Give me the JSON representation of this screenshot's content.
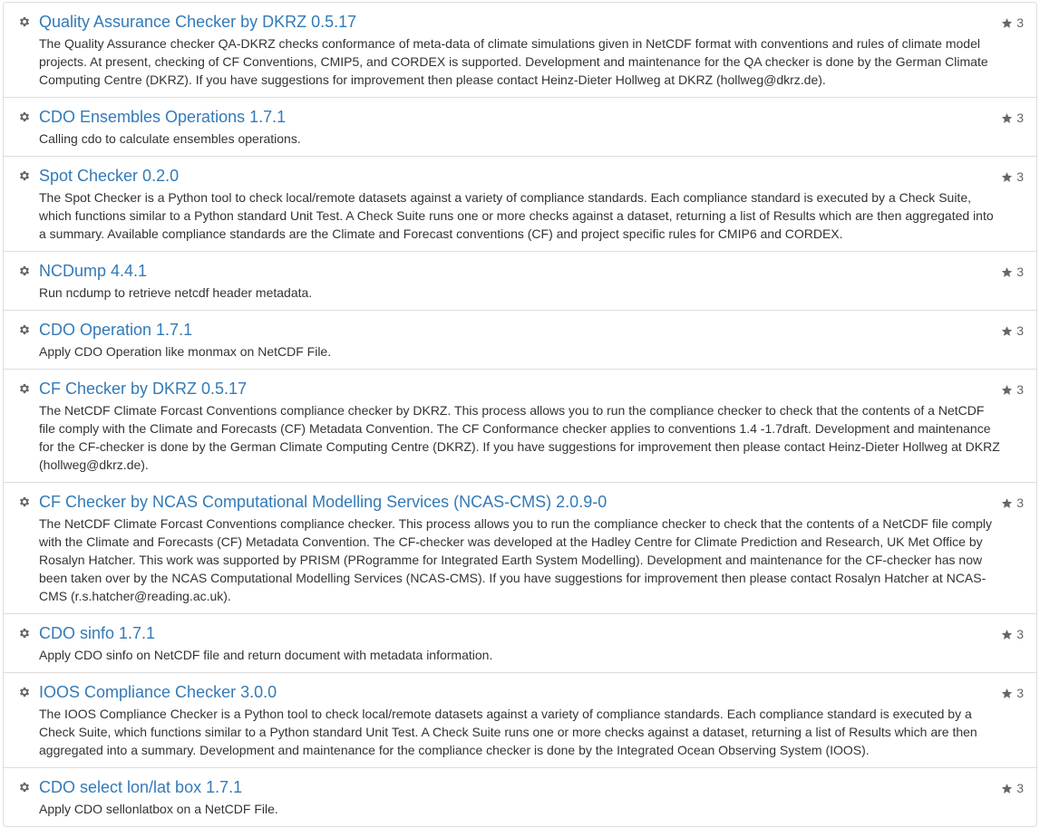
{
  "processes": [
    {
      "title": "Quality Assurance Checker by DKRZ 0.5.17",
      "description": "The Quality Assurance checker QA-DKRZ checks conformance of meta-data of climate simulations given in NetCDF format with conventions and rules of climate model projects. At present, checking of CF Conventions, CMIP5, and CORDEX is supported. Development and maintenance for the QA checker is done by the German Climate Computing Centre (DKRZ). If you have suggestions for improvement then please contact Heinz-Dieter Hollweg at DKRZ (hollweg@dkrz.de).",
      "stars": "3",
      "icon": "gear-icon"
    },
    {
      "title": "CDO Ensembles Operations 1.7.1",
      "description": "Calling cdo to calculate ensembles operations.",
      "stars": "3",
      "icon": "gear-icon"
    },
    {
      "title": "Spot Checker 0.2.0",
      "description": "The Spot Checker is a Python tool to check local/remote datasets against a variety of compliance standards. Each compliance standard is executed by a Check Suite, which functions similar to a Python standard Unit Test. A Check Suite runs one or more checks against a dataset, returning a list of Results which are then aggregated into a summary. Available compliance standards are the Climate and Forecast conventions (CF) and project specific rules for CMIP6 and CORDEX.",
      "stars": "3",
      "icon": "gear-icon"
    },
    {
      "title": "NCDump 4.4.1",
      "description": "Run ncdump to retrieve netcdf header metadata.",
      "stars": "3",
      "icon": "gear-icon"
    },
    {
      "title": "CDO Operation 1.7.1",
      "description": "Apply CDO Operation like monmax on NetCDF File.",
      "stars": "3",
      "icon": "gear-icon"
    },
    {
      "title": "CF Checker by DKRZ 0.5.17",
      "description": "The NetCDF Climate Forcast Conventions compliance checker by DKRZ. This process allows you to run the compliance checker to check that the contents of a NetCDF file comply with the Climate and Forecasts (CF) Metadata Convention. The CF Conformance checker applies to conventions 1.4 -1.7draft. Development and maintenance for the CF-checker is done by the German Climate Computing Centre (DKRZ). If you have suggestions for improvement then please contact Heinz-Dieter Hollweg at DKRZ (hollweg@dkrz.de).",
      "stars": "3",
      "icon": "gear-icon"
    },
    {
      "title": "CF Checker by NCAS Computational Modelling Services (NCAS-CMS) 2.0.9-0",
      "description": "The NetCDF Climate Forcast Conventions compliance checker. This process allows you to run the compliance checker to check that the contents of a NetCDF file comply with the Climate and Forecasts (CF) Metadata Convention. The CF-checker was developed at the Hadley Centre for Climate Prediction and Research, UK Met Office by Rosalyn Hatcher. This work was supported by PRISM (PRogramme for Integrated Earth System Modelling). Development and maintenance for the CF-checker has now been taken over by the NCAS Computational Modelling Services (NCAS-CMS). If you have suggestions for improvement then please contact Rosalyn Hatcher at NCAS-CMS (r.s.hatcher@reading.ac.uk).",
      "stars": "3",
      "icon": "gear-icon"
    },
    {
      "title": "CDO sinfo 1.7.1",
      "description": "Apply CDO sinfo on NetCDF file and return document with metadata information.",
      "stars": "3",
      "icon": "gear-icon"
    },
    {
      "title": "IOOS Compliance Checker 3.0.0",
      "description": "The IOOS Compliance Checker is a Python tool to check local/remote datasets against a variety of compliance standards. Each compliance standard is executed by a Check Suite, which functions similar to a Python standard Unit Test. A Check Suite runs one or more checks against a dataset, returning a list of Results which are then aggregated into a summary. Development and maintenance for the compliance checker is done by the Integrated Ocean Observing System (IOOS).",
      "stars": "3",
      "icon": "gear-icon"
    },
    {
      "title": "CDO select lon/lat box 1.7.1",
      "description": "Apply CDO sellonlatbox on a NetCDF File.",
      "stars": "3",
      "icon": "gear-icon"
    }
  ],
  "colors": {
    "link": "#337ab7",
    "text": "#333333",
    "muted": "#666666",
    "border": "#dddddd"
  }
}
